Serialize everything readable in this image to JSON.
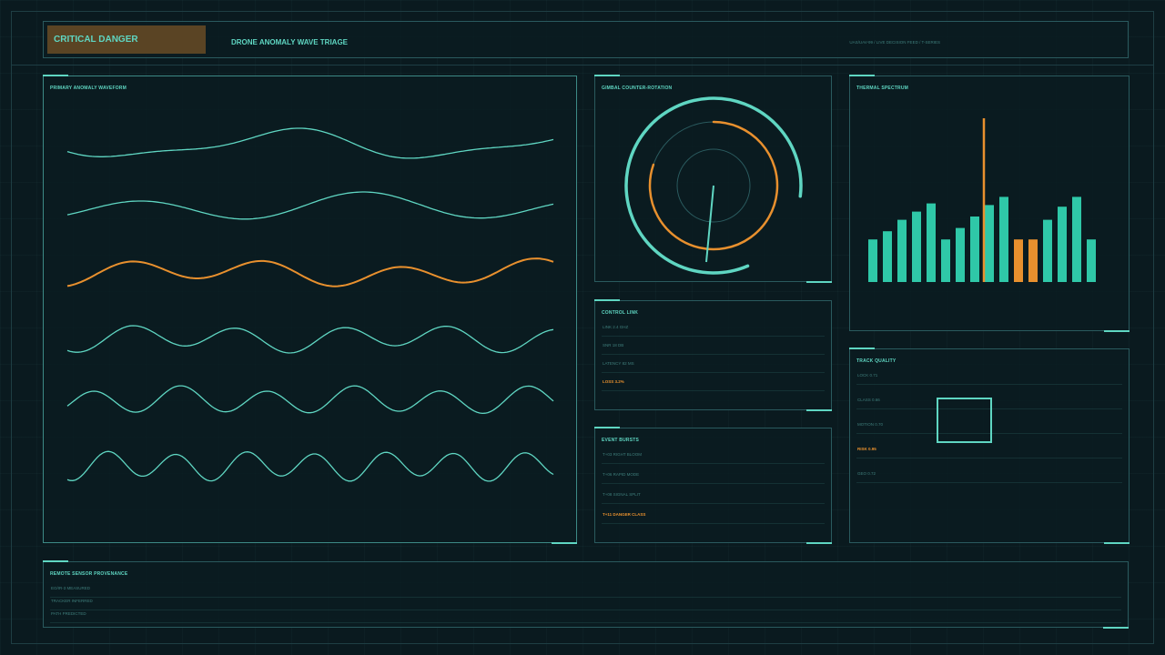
{
  "header": {
    "badge": "CRITICAL DANGER",
    "title": "DRONE ANOMALY WAVE TRIAGE",
    "meta": "UAS/UAV-99 / LIVE DECISION FEED / T-SERIES"
  },
  "panels": {
    "waveform_title": "PRIMARY ANOMALY WAVEFORM",
    "gimbal_title": "GIMBAL COUNTER-ROTATION",
    "thermal_title": "THERMAL SPECTRUM",
    "control_title": "CONTROL LINK",
    "events_title": "EVENT BURSTS",
    "track_title": "TRACK QUALITY",
    "provenance_title": "REMOTE SENSOR PROVENANCE"
  },
  "control_link": [
    {
      "text": "LINK 2.4 GHZ",
      "warn": false
    },
    {
      "text": "SNR 18 DB",
      "warn": false
    },
    {
      "text": "LATENCY 82 MS",
      "warn": false
    },
    {
      "text": "LOSS 3.2%",
      "warn": true
    }
  ],
  "events": [
    {
      "text": "T+03 RIGHT BLOOM",
      "warn": false
    },
    {
      "text": "T+06 RAPID MODE",
      "warn": false
    },
    {
      "text": "T+08 SIGNAL SPLIT",
      "warn": false
    },
    {
      "text": "T+11 DANGER CLASS",
      "warn": true
    }
  ],
  "track_quality": [
    {
      "text": "LOCK 0.71",
      "warn": false
    },
    {
      "text": "CLASS 0.66",
      "warn": false
    },
    {
      "text": "MOTION 0.70",
      "warn": false
    },
    {
      "text": "RISK 0.95",
      "warn": true
    },
    {
      "text": "GEO 0.72",
      "warn": false
    }
  ],
  "provenance": [
    {
      "text": "EO/IR-3 MEASURED"
    },
    {
      "text": "TRACKER INFERRED"
    },
    {
      "text": "PATH PREDICTED"
    }
  ],
  "colors": {
    "teal": "#5fd6c2",
    "orange": "#e8902e",
    "dim": "#2a5a5e"
  },
  "waveforms": {
    "highlight_index": 2,
    "count": 6
  },
  "thermal": {
    "values": [
      0.26,
      0.31,
      0.38,
      0.43,
      0.48,
      0.26,
      0.33,
      0.4,
      0.47,
      0.52,
      0.26,
      0.26,
      0.38,
      0.46,
      0.52,
      0.26
    ],
    "highlight": [
      false,
      false,
      false,
      false,
      false,
      false,
      false,
      false,
      false,
      false,
      true,
      true,
      false,
      false,
      false,
      false
    ],
    "marker_value": 1.0
  },
  "gimbal": {
    "outer_arc_fraction": 0.62,
    "inner_arc_fraction": 0.72,
    "needle_angle_deg": 187
  }
}
